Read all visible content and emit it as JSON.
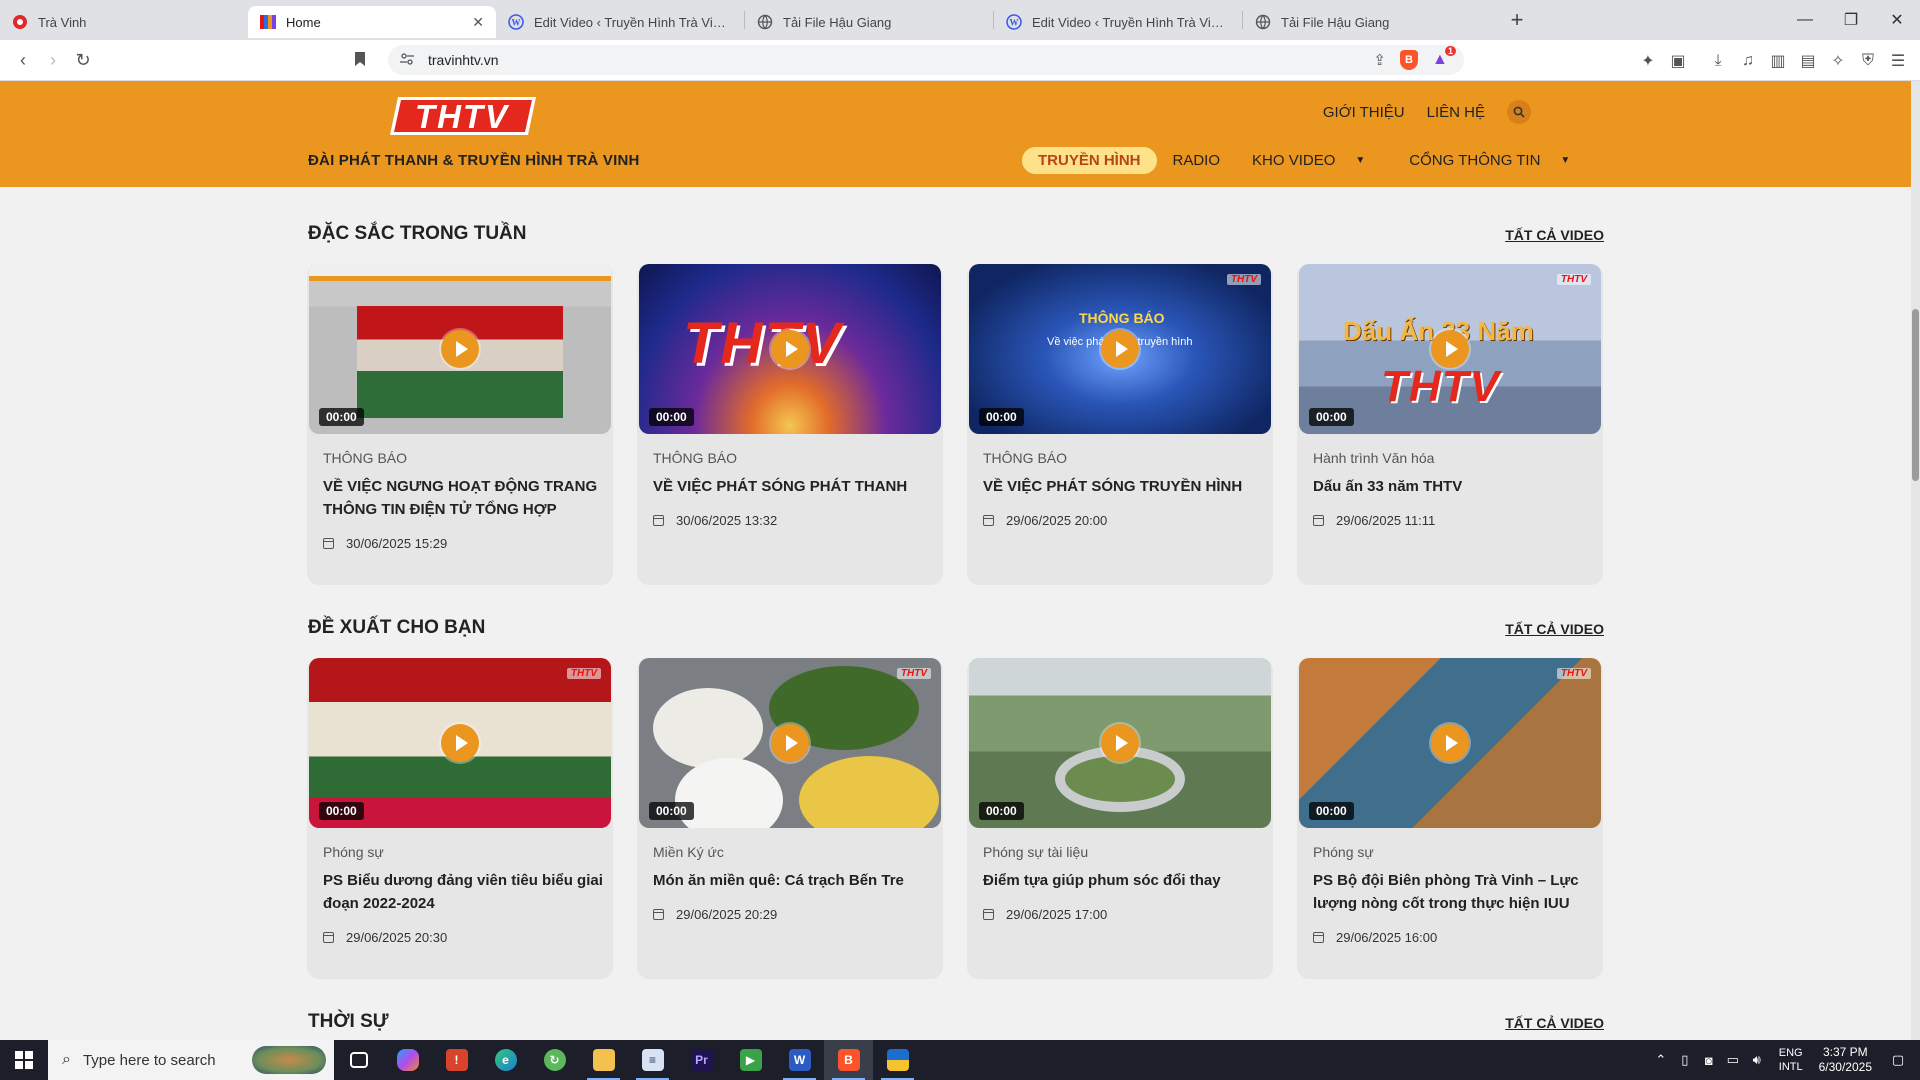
{
  "browser": {
    "tabs": [
      {
        "title": "Trà Vinh",
        "favicon": "audio-muted-record-icon",
        "active": false,
        "closable": false
      },
      {
        "title": "Home",
        "favicon": "thtv-favicon-icon",
        "active": true,
        "closable": true
      },
      {
        "title": "Edit Video ‹ Truyền Hình Trà Vinh — WordPress",
        "favicon": "wordpress-icon",
        "active": false,
        "closable": false
      },
      {
        "title": "Tải File Hậu Giang",
        "favicon": "globe-icon",
        "active": false,
        "closable": false
      },
      {
        "title": "Edit Video ‹ Truyền Hình Trà Vinh — WordPress",
        "favicon": "wordpress-icon",
        "active": false,
        "closable": false
      },
      {
        "title": "Tải File Hậu Giang",
        "favicon": "globe-icon",
        "active": false,
        "closable": false
      }
    ],
    "url": "travinhtv.vn",
    "rewards_badge": "1"
  },
  "site": {
    "logo_text": "THTV",
    "tagline": "ĐÀI PHÁT THANH & TRUYỀN HÌNH TRÀ VINH",
    "top_links": [
      "GIỚI THIỆU",
      "LIÊN HỆ"
    ],
    "nav": [
      {
        "label": "TRUYỀN HÌNH",
        "active": true,
        "dropdown": false
      },
      {
        "label": "RADIO",
        "active": false,
        "dropdown": false
      },
      {
        "label": "KHO VIDEO",
        "active": false,
        "dropdown": true
      },
      {
        "label": "CỔNG THÔNG TIN",
        "active": false,
        "dropdown": true
      }
    ],
    "accent_color": "#eb961e"
  },
  "sections": [
    {
      "title": "ĐẶC SẮC TRONG TUẦN",
      "see_all": "TẤT CẢ VIDEO",
      "cards": [
        {
          "duration": "00:00",
          "category": "THÔNG BÁO",
          "title": "VỀ VIỆC NGƯNG HOẠT ĐỘNG TRANG THÔNG TIN ĐIỆN TỬ TỔNG HỢP",
          "date": "30/06/2025 15:29"
        },
        {
          "duration": "00:00",
          "category": "THÔNG BÁO",
          "title": "VỀ VIỆC PHÁT SÓNG PHÁT THANH",
          "date": "30/06/2025 13:32"
        },
        {
          "duration": "00:00",
          "category": "THÔNG BÁO",
          "title": "VỀ VIỆC PHÁT SÓNG TRUYỀN HÌNH",
          "date": "29/06/2025 20:00"
        },
        {
          "duration": "00:00",
          "category": "Hành trình Văn hóa",
          "title": "Dấu ấn 33 năm THTV",
          "date": "29/06/2025 11:11"
        }
      ]
    },
    {
      "title": "ĐỀ XUẤT CHO BẠN",
      "see_all": "TẤT CẢ VIDEO",
      "cards": [
        {
          "duration": "00:00",
          "category": "Phóng sự",
          "title": "PS Biểu dương đảng viên tiêu biểu giai đoạn 2022-2024",
          "date": "29/06/2025 20:30"
        },
        {
          "duration": "00:00",
          "category": "Miền Ký ức",
          "title": "Món ăn miền quê: Cá trạch Bến Tre",
          "date": "29/06/2025 20:29"
        },
        {
          "duration": "00:00",
          "category": "Phóng sự tài liệu",
          "title": "Điểm tựa giúp phum sóc đổi thay",
          "date": "29/06/2025 17:00"
        },
        {
          "duration": "00:00",
          "category": "Phóng sự",
          "title": "PS Bộ đội Biên phòng Trà Vinh – Lực lượng nòng cốt trong thực hiện IUU",
          "date": "29/06/2025 16:00"
        }
      ]
    },
    {
      "title": "THỜI SỰ",
      "see_all": "TẤT CẢ VIDEO",
      "cards": []
    }
  ],
  "thumb_text": {
    "thong_bao": "THÔNG BÁO",
    "thong_bao_sub": "Về việc phát sóng truyền hình",
    "dau_an": "Dấu Ấn 33 Năm",
    "watermark": "THTV"
  },
  "taskbar": {
    "search_placeholder": "Type here to search",
    "apps": [
      "task-view-icon",
      "copilot-icon",
      "red-app-icon",
      "edge-icon",
      "green-app-icon",
      "file-explorer-icon",
      "notepad-icon",
      "premiere-pro-icon",
      "media-player-icon",
      "word-icon",
      "brave-icon",
      "sticky-app-icon"
    ],
    "lang_1": "ENG",
    "lang_2": "INTL",
    "time": "3:37 PM",
    "date": "6/30/2025"
  }
}
